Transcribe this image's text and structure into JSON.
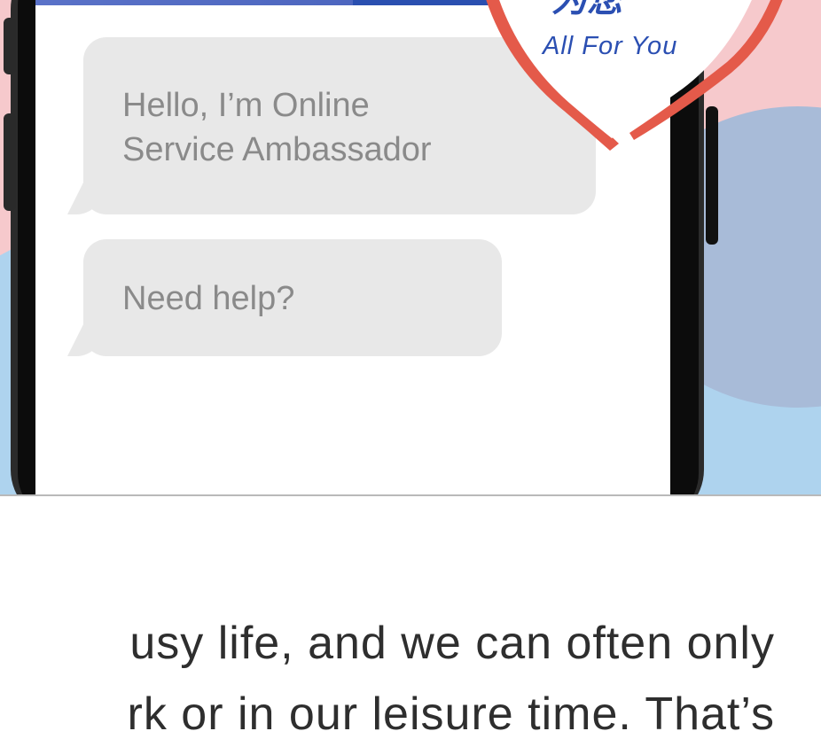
{
  "chat": {
    "messages": [
      {
        "lines": [
          "Hello, I’m Online",
          "Service Ambassador"
        ]
      },
      {
        "lines": [
          "Need help?"
        ]
      }
    ]
  },
  "badge": {
    "logo_text": "为您",
    "tagline": "All For You"
  },
  "article": {
    "lines": [
      "usy life, and we can often only",
      "rk or in our leisure time. That’s"
    ]
  },
  "colors": {
    "brand_blue": "#2b4fb2",
    "badge_red": "#e45a4a",
    "bubble_gray": "#e8e8e8",
    "background_pink": "#f6c9cc",
    "background_blue": "#aed3ee"
  },
  "icons": {
    "badge": "shield-badge-icon"
  }
}
